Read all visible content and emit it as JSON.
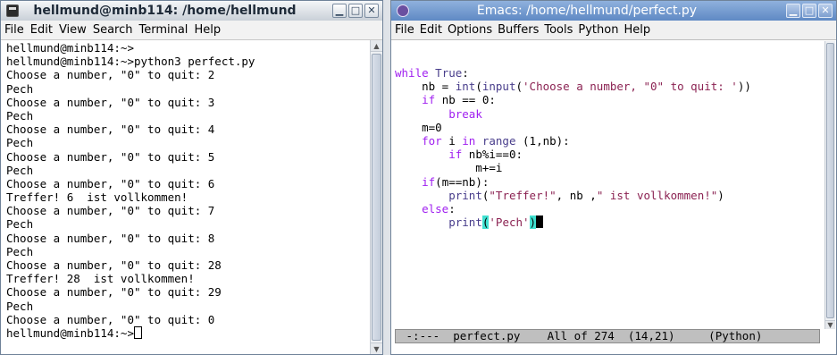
{
  "terminal": {
    "title": "hellmund@minb114: /home/hellmund",
    "menu": [
      "File",
      "Edit",
      "View",
      "Search",
      "Terminal",
      "Help"
    ],
    "lines": [
      "hellmund@minb114:~>",
      "hellmund@minb114:~>python3 perfect.py",
      "Choose a number, \"0\" to quit: 2",
      "Pech",
      "Choose a number, \"0\" to quit: 3",
      "Pech",
      "Choose a number, \"0\" to quit: 4",
      "Pech",
      "Choose a number, \"0\" to quit: 5",
      "Pech",
      "Choose a number, \"0\" to quit: 6",
      "Treffer! 6  ist vollkommen!",
      "Choose a number, \"0\" to quit: 7",
      "Pech",
      "Choose a number, \"0\" to quit: 8",
      "Pech",
      "Choose a number, \"0\" to quit: 28",
      "Treffer! 28  ist vollkommen!",
      "Choose a number, \"0\" to quit: 29",
      "Pech",
      "Choose a number, \"0\" to quit: 0"
    ],
    "prompt": "hellmund@minb114:~>"
  },
  "emacs": {
    "title": "Emacs: /home/hellmund/perfect.py",
    "menu": [
      "File",
      "Edit",
      "Options",
      "Buffers",
      "Tools",
      "Python",
      "Help"
    ],
    "code": {
      "l1_kw": "while",
      "l1_true": "True",
      "l1_rest": ":",
      "l2_a": "    nb = ",
      "l2_int": "int",
      "l2_b": "(",
      "l2_input": "input",
      "l2_c": "(",
      "l2_str": "'Choose a number, \"0\" to quit: '",
      "l2_d": "))",
      "l3_if": "if",
      "l3_rest": " nb == 0:",
      "l4_break": "break",
      "l5": "    m=0",
      "l6_for": "for",
      "l6_a": " i ",
      "l6_in": "in",
      "l6_b": " ",
      "l6_range": "range",
      "l6_c": " (1,nb):",
      "l7_if": "if",
      "l7_rest": " nb%i==0:",
      "l8": "            m+=i",
      "l9_if": "if",
      "l9_rest": "(m==nb):",
      "l10_print": "print",
      "l10_a": "(",
      "l10_s1": "\"Treffer!\"",
      "l10_b": ", nb ,",
      "l10_s2": "\" ist vollkommen!\"",
      "l10_c": ")",
      "l11_else": "else",
      "l11_rest": ":",
      "l12_print": "print",
      "l12_open": "(",
      "l12_str": "'Pech'",
      "l12_close": ")"
    },
    "modeline": " -:---  perfect.py    All of 274  (14,21)     (Python)"
  },
  "colors": {
    "keyword": "#a020f0",
    "builtin": "#483d8b",
    "string": "#8b2252",
    "paren_match": "#40e0d0"
  }
}
